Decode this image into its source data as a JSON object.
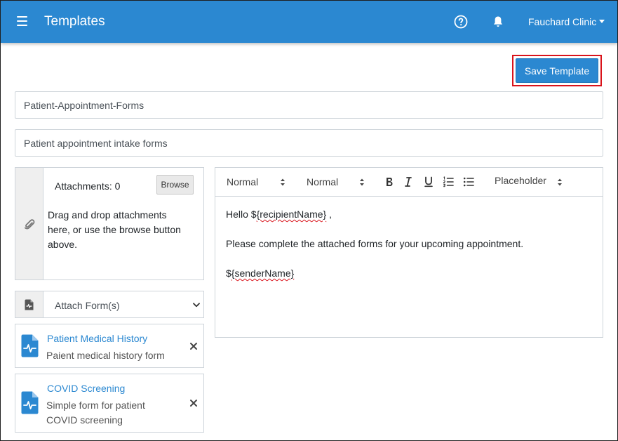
{
  "header": {
    "title": "Templates",
    "clinic": "Fauchard Clinic",
    "bg_color": "#2b88d1"
  },
  "actions": {
    "save_label": "Save Template",
    "highlight_color": "#d9131b"
  },
  "fields": {
    "name_value": "Patient-Appointment-Forms",
    "description_value": "Patient appointment intake forms"
  },
  "attachments": {
    "count_label": "Attachments: 0",
    "browse_label": "Browse",
    "drop_line_1": "Drag and drop attachments",
    "drop_line_2": "here, or use the browse button",
    "drop_line_3": "above."
  },
  "attach_forms": {
    "select_label": "Attach Form(s)"
  },
  "forms": [
    {
      "title": "Patient Medical History",
      "desc_line_1": "Paient medical history form",
      "desc_line_2": ""
    },
    {
      "title": "COVID Screening",
      "desc_line_1": "Simple form for patient",
      "desc_line_2": "COVID screening"
    }
  ],
  "editor": {
    "toolbar": {
      "font_select": "Normal",
      "size_select": "Normal",
      "placeholder_select": "Placeholder"
    },
    "body": {
      "greeting_prefix": "Hello $",
      "recipient_token": "{recipientName}",
      "greeting_suffix": " ,",
      "message": "Please complete the attached forms for your upcoming appointment.",
      "signature_prefix": "$",
      "sender_token": "{senderName}"
    }
  }
}
